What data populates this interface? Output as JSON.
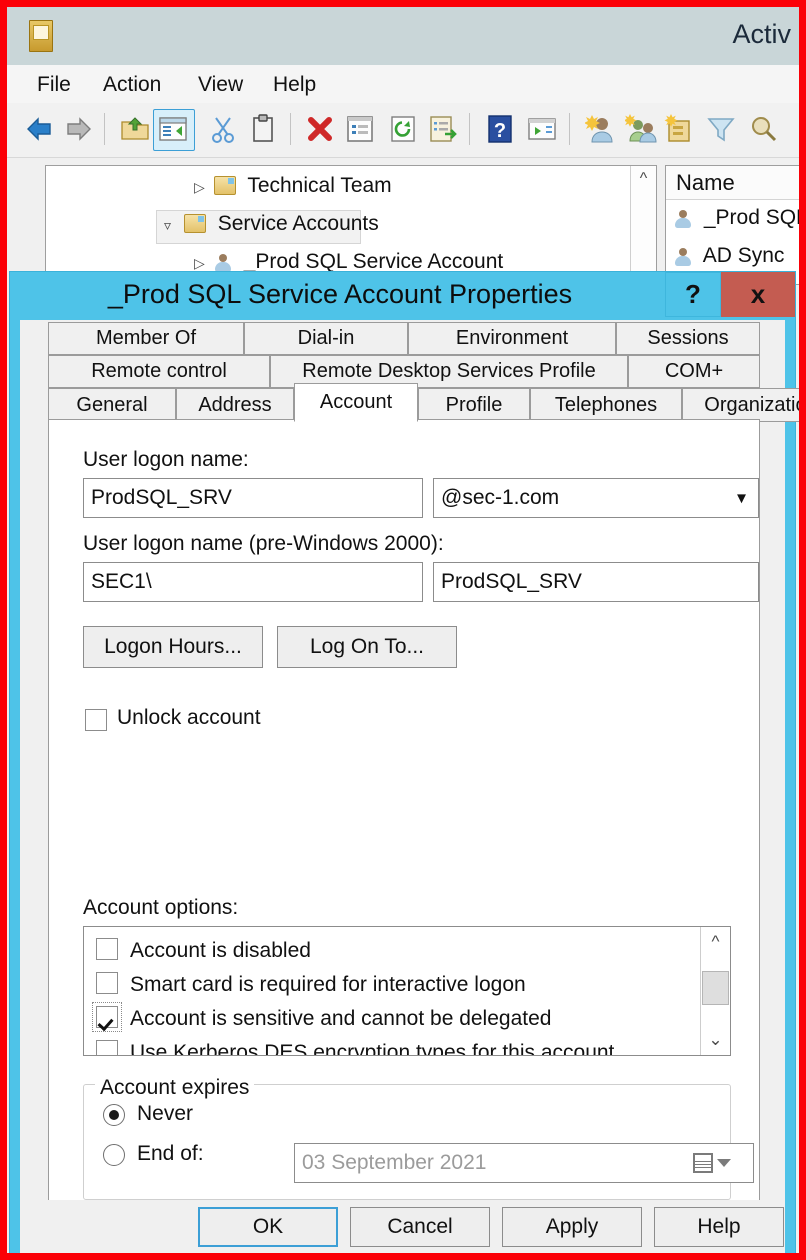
{
  "window": {
    "title": "Activ",
    "app_icon": "console-icon",
    "menu": [
      "File",
      "Action",
      "View",
      "Help"
    ],
    "toolbar_icons": [
      "back-arrow-icon",
      "forward-arrow-icon",
      "up-folder-icon",
      "show-hide-console-tree-icon",
      "cut-icon",
      "paste-icon",
      "delete-icon",
      "properties-icon",
      "refresh-icon",
      "export-list-icon",
      "help-icon",
      "show-hide-action-pane-icon",
      "new-user-icon",
      "new-group-icon",
      "new-ou-icon",
      "filter-icon",
      "find-icon"
    ]
  },
  "tree": {
    "items": [
      {
        "label": "Technical Team",
        "icon": "ou-folder-icon",
        "expander": "collapsed",
        "indent": 148,
        "selected": false
      },
      {
        "label": "Service Accounts",
        "icon": "ou-folder-icon",
        "expander": "expanded",
        "indent": 118,
        "selected": true
      },
      {
        "label": "_Prod SQL Service Account",
        "icon": "user-icon",
        "expander": "collapsed",
        "indent": 148,
        "selected": false
      }
    ]
  },
  "list_pane": {
    "column_header": "Name",
    "rows": [
      {
        "label": "_Prod SQL",
        "icon": "user-icon"
      },
      {
        "label": "AD Sync",
        "icon": "user-icon"
      }
    ]
  },
  "dialog": {
    "title": "_Prod SQL Service Account Properties",
    "help_button": "?",
    "close_button": "x",
    "titlebar_color": "#4ec3e8",
    "close_color": "#c45c51",
    "tabs_row1": [
      "Member Of",
      "Dial-in",
      "Environment",
      "Sessions"
    ],
    "tabs_row2": [
      "Remote control",
      "Remote Desktop Services Profile",
      "COM+"
    ],
    "tabs_row3": [
      "General",
      "Address",
      "Account",
      "Profile",
      "Telephones",
      "Organization"
    ],
    "active_tab": "Account",
    "account": {
      "logon_name_label": "User logon name:",
      "logon_name_value": "ProdSQL_SRV",
      "upn_suffix_value": "@sec-1.com",
      "pre2000_label": "User logon name (pre-Windows 2000):",
      "pre2000_domain": "SEC1\\",
      "pre2000_value": "ProdSQL_SRV",
      "logon_hours_button": "Logon Hours...",
      "log_on_to_button": "Log On To...",
      "unlock_label": "Unlock account",
      "unlock_checked": false,
      "options_label": "Account options:",
      "options": [
        {
          "label": "Account is disabled",
          "checked": false,
          "focused": false
        },
        {
          "label": "Smart card is required for interactive logon",
          "checked": false,
          "focused": false
        },
        {
          "label": "Account is sensitive and cannot be delegated",
          "checked": true,
          "focused": true
        },
        {
          "label": "Use Kerberos DES encryption types for this account",
          "checked": false,
          "focused": false
        }
      ],
      "expires_legend": "Account expires",
      "expires_never_label": "Never",
      "expires_never_selected": true,
      "expires_end_label": "End of:",
      "expires_end_selected": false,
      "expires_date": "03 September 2021"
    },
    "buttons": {
      "ok": "OK",
      "cancel": "Cancel",
      "apply": "Apply",
      "help": "Help"
    }
  }
}
